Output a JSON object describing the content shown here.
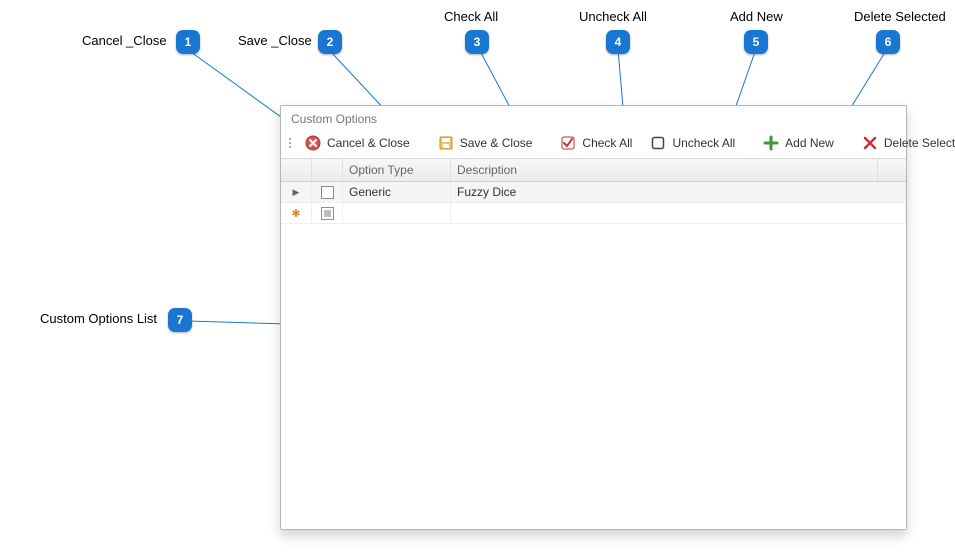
{
  "callouts": {
    "c1": "Cancel _Close",
    "c2": "Save _Close",
    "c3": "Check All",
    "c4": "Uncheck All",
    "c5": "Add New",
    "c6": "Delete Selected",
    "c7": "Custom Options List"
  },
  "window": {
    "title": "Custom Options"
  },
  "toolbar": {
    "cancel_close": "Cancel & Close",
    "save_close": "Save & Close",
    "check_all": "Check All",
    "uncheck_all": "Uncheck All",
    "add_new": "Add New",
    "delete_selected": "Delete Selected"
  },
  "grid": {
    "headers": {
      "option_type": "Option Type",
      "description": "Description"
    },
    "rows": [
      {
        "indicator": "current",
        "checked": false,
        "option_type": "Generic",
        "description": "Fuzzy Dice"
      },
      {
        "indicator": "new",
        "checked": "indeterminate",
        "option_type": "",
        "description": ""
      }
    ]
  }
}
